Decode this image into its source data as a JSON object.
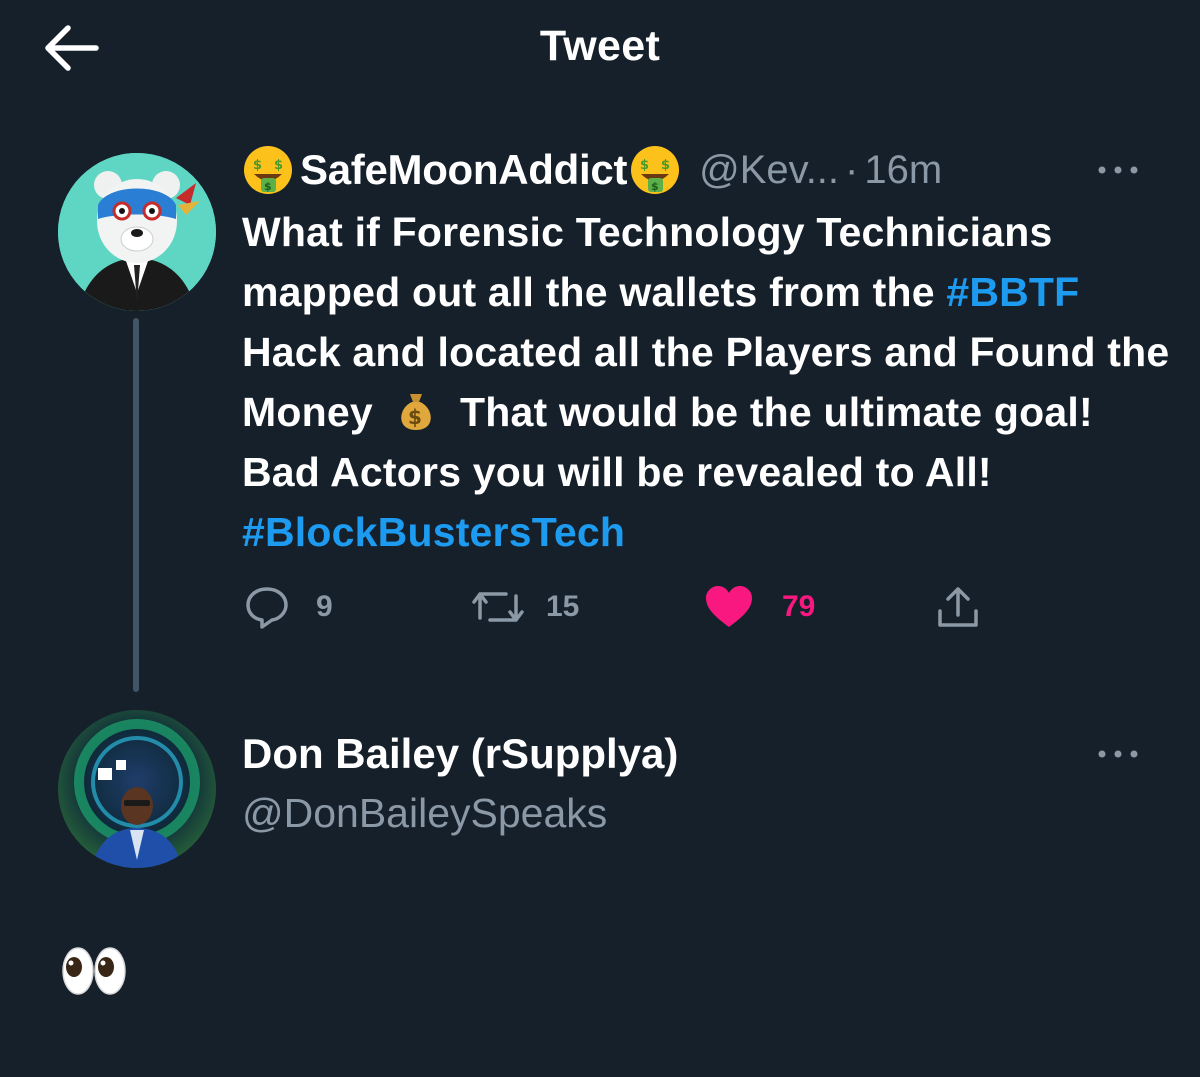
{
  "header": {
    "title": "Tweet",
    "back_icon": "arrow-left-icon"
  },
  "tweet": {
    "display_name": "SafeMoonAddict",
    "name_emoji": "money-mouth-face-emoji",
    "handle": "@Kev...",
    "separator": "·",
    "time": "16m",
    "more_icon": "ellipsis-icon",
    "text": {
      "part1": "What if Forensic Technology Technicians mapped out all the wallets from the ",
      "hashtag1": "#BBTF",
      "part2": " Hack and located all the Players and Found the Money ",
      "emoji": "money-bag-emoji",
      "part3": " That would be the ultimate goal! Bad Actors you will be revealed to All! ",
      "hashtag2": "#BlockBustersTech"
    },
    "actions": {
      "replies": "9",
      "retweets": "15",
      "likes": "79",
      "liked": true
    },
    "colors": {
      "link": "#1d9bf0",
      "like": "#f91880",
      "muted": "#8b98a5",
      "background": "#15202b"
    }
  },
  "reply": {
    "display_name": "Don Bailey (rSupplya)",
    "handle": "@DonBaileySpeaks",
    "more_icon": "ellipsis-icon",
    "content_emoji": "eyes-emoji"
  }
}
